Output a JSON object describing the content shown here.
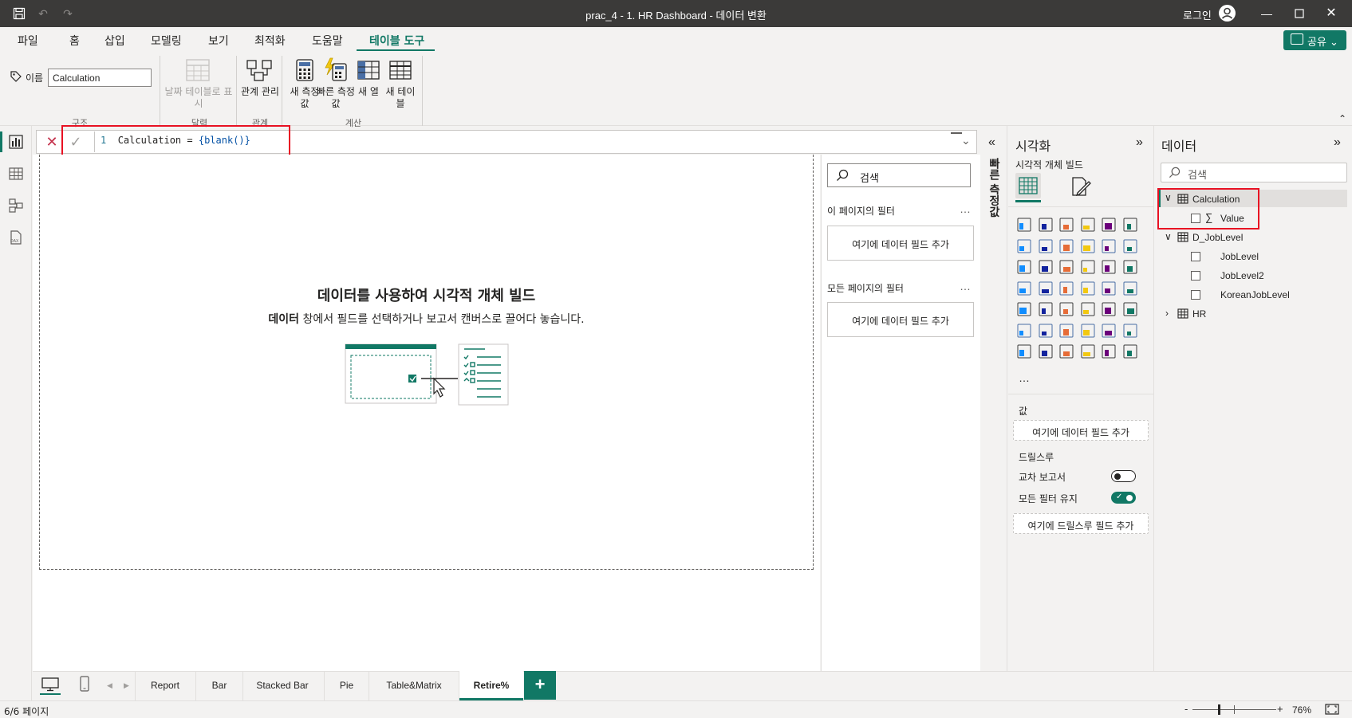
{
  "window": {
    "title": "prac_4 - 1. HR Dashboard - 데이터 변환",
    "signin": "로그인"
  },
  "menu": {
    "tabs": [
      "파일",
      "홈",
      "삽입",
      "모델링",
      "보기",
      "최적화",
      "도움말",
      "테이블 도구"
    ],
    "active": "테이블 도구",
    "share": "공유"
  },
  "ribbon": {
    "name_label": "이름",
    "name_value": "Calculation",
    "group_structure": "구조",
    "mark_date_table": "날짜 테이블로 표시",
    "group_calendar": "달력",
    "manage_relationships": "관계 관리",
    "group_relationships": "관계",
    "new_measure": "새 측정값",
    "quick_measure": "빠른 측정값",
    "new_column": "새 열",
    "new_table": "새 테이블",
    "group_calculations": "계산"
  },
  "formula": {
    "line_no": "1",
    "text_prefix": "Calculation = ",
    "text_expr": "{blank()}"
  },
  "canvas": {
    "empty_title": "데이터를 사용하여 시각적 개체 빌드",
    "empty_sub_bold": "데이터",
    "empty_sub_rest": " 창에서 필드를 선택하거나 보고서 캔버스로 끌어다 놓습니다."
  },
  "filters": {
    "search_placeholder": "검색",
    "page_filters": "이 페이지의 필터",
    "all_filters": "모든 페이지의 필터",
    "add_field": "여기에 데이터 필드 추가",
    "more": "…"
  },
  "quick_measure_strip": "빠른 측정값",
  "viz": {
    "title": "시각화",
    "build": "시각적 개체 빌드",
    "more": "…",
    "values_label": "값",
    "values_add": "여기에 데이터 필드 추가",
    "drill": "드릴스루",
    "cross_report": "교차 보고서",
    "keep_filters": "모든 필터 유지",
    "drill_add": "여기에 드릴스루 필드 추가",
    "cross_report_on": false,
    "keep_filters_on": true
  },
  "data": {
    "title": "데이터",
    "search_placeholder": "검색",
    "tables": [
      {
        "name": "Calculation",
        "expanded": true,
        "fields": [
          "Value"
        ]
      },
      {
        "name": "D_JobLevel",
        "expanded": true,
        "fields": [
          "JobLevel",
          "JobLevel2",
          "KoreanJobLevel"
        ]
      },
      {
        "name": "HR",
        "expanded": false,
        "fields": []
      }
    ]
  },
  "pages": {
    "tabs": [
      "Report",
      "Bar",
      "Stacked Bar",
      "Pie",
      "Table&Matrix",
      "Retire%"
    ],
    "active": "Retire%",
    "add": "+"
  },
  "status": {
    "page_info": "6/6 페이지",
    "zoom": "76%",
    "zoom_minus": "-",
    "zoom_plus": "+"
  },
  "colors": {
    "accent": "#117865",
    "highlight_box": "#e81123",
    "titlebar": "#3b3a39"
  }
}
